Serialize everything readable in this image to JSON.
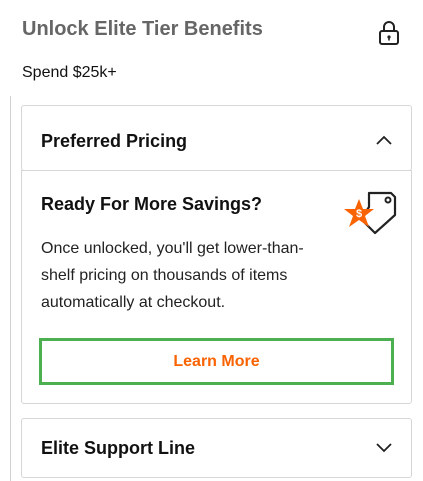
{
  "header": {
    "title": "Unlock Elite Tier Benefits",
    "subtitle": "Spend $25k+",
    "lock_icon": "lock-icon"
  },
  "accordion": {
    "preferred_pricing": {
      "title": "Preferred Pricing",
      "expanded": true,
      "toggle_icon": "chevron-up-icon",
      "body": {
        "heading": "Ready For More Savings?",
        "icon": "price-tag-star-icon",
        "text": "Once unlocked, you'll get lower-than-shelf pricing on thousands of items automatically at checkout.",
        "button_label": "Learn More"
      }
    },
    "elite_support": {
      "title": "Elite Support Line",
      "expanded": false,
      "toggle_icon": "chevron-down-icon"
    }
  },
  "colors": {
    "accent_orange": "#f96302",
    "highlight_green": "#4caf50",
    "header_gray": "#666666"
  }
}
